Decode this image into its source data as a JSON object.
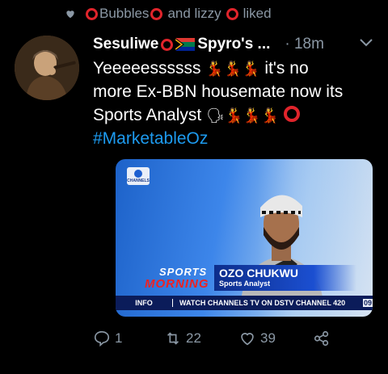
{
  "social_context": {
    "name1": "Bubbles",
    "and_text": "and lizzy",
    "liked": "liked"
  },
  "tweet": {
    "author": "Sesuliwe",
    "author_tail": "Spyro's ...",
    "time": "· 18m",
    "text_line1": "Yeeeeessssss",
    "text_line1_tail": "it's no",
    "text_line2": "more Ex-BBN housemate now its",
    "text_line3": "Sports Analyst",
    "hashtag": "#MarketableOz"
  },
  "media": {
    "channel_logo": "CHANNELS",
    "show_line1": "SPORTS",
    "show_line2": "MORNING",
    "guest_name": "OZO CHUKWU",
    "guest_role": "Sports Analyst",
    "ticker_label": "INFO",
    "ticker_text": "WATCH CHANNELS TV ON DSTV CHANNEL 420",
    "ticker_num": "09"
  },
  "actions": {
    "replies": "1",
    "retweets": "22",
    "likes": "39"
  },
  "colors": {
    "accent": "#1d9bf0",
    "muted": "#8b98a5",
    "ring": "#e0242b"
  },
  "icons": [
    "heart-icon",
    "chevron-down-icon",
    "reply-icon",
    "retweet-icon",
    "like-icon",
    "share-icon"
  ]
}
